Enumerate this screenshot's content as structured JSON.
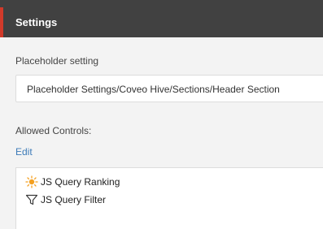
{
  "header": {
    "title": "Settings"
  },
  "placeholder_setting": {
    "label": "Placeholder setting",
    "value": "Placeholder Settings/Coveo Hive/Sections/Header Section"
  },
  "allowed_controls": {
    "label": "Allowed Controls:",
    "edit_label": "Edit",
    "items": [
      {
        "label": "JS Query Ranking",
        "icon": "ranking-sun-icon"
      },
      {
        "label": "JS Query Filter",
        "icon": "filter-funnel-icon"
      }
    ]
  },
  "colors": {
    "header_background": "#414141",
    "accent": "#d23a2a",
    "link": "#3d7bb8",
    "panel_background": "#f3f3f3"
  }
}
